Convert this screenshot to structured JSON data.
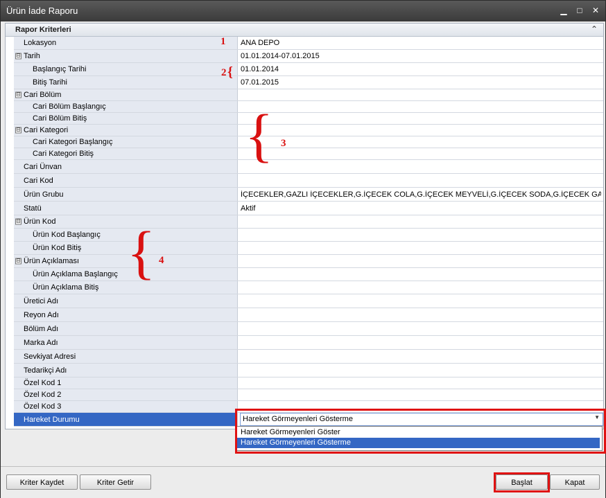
{
  "window": {
    "title": "Ürün İade Raporu",
    "min": "▁",
    "max": "□",
    "close": "✕"
  },
  "group": {
    "title": "Rapor Kriterleri",
    "collapse": "⌃"
  },
  "rows": [
    {
      "label": "Lokasyon",
      "value": "ANA DEPO"
    },
    {
      "label": "Tarih",
      "value": "01.01.2014-07.01.2015"
    },
    {
      "label": "Başlangıç Tarihi",
      "value": "01.01.2014"
    },
    {
      "label": "Bitiş Tarihi",
      "value": "07.01.2015"
    },
    {
      "label": "Cari Bölüm",
      "value": ""
    },
    {
      "label": "Cari Bölüm Başlangıç",
      "value": ""
    },
    {
      "label": "Cari Bölüm Bitiş",
      "value": ""
    },
    {
      "label": "Cari Kategori",
      "value": ""
    },
    {
      "label": "Cari Kategori Başlangıç",
      "value": ""
    },
    {
      "label": "Cari Kategori Bitiş",
      "value": ""
    },
    {
      "label": "Cari Ünvan",
      "value": ""
    },
    {
      "label": "Cari Kod",
      "value": ""
    },
    {
      "label": "Ürün Grubu",
      "value": "İÇECEKLER,GAZLI İÇECEKLER,G.İÇECEK COLA,G.İÇECEK MEYVELİ,G.İÇECEK SODA,G.İÇECEK GAZOZ,G...."
    },
    {
      "label": "Statü",
      "value": "Aktif"
    },
    {
      "label": "Ürün Kod",
      "value": ""
    },
    {
      "label": "Ürün Kod Başlangıç",
      "value": ""
    },
    {
      "label": "Ürün Kod Bitiş",
      "value": ""
    },
    {
      "label": "Ürün Açıklaması",
      "value": ""
    },
    {
      "label": "Ürün Açıklama Başlangıç",
      "value": ""
    },
    {
      "label": "Ürün Açıklama Bitiş",
      "value": ""
    },
    {
      "label": "Üretici Adı",
      "value": ""
    },
    {
      "label": "Reyon Adı",
      "value": ""
    },
    {
      "label": "Bölüm Adı",
      "value": ""
    },
    {
      "label": "Marka Adı",
      "value": ""
    },
    {
      "label": "Sevkiyat Adresi",
      "value": ""
    },
    {
      "label": "Tedarikçi Adı",
      "value": ""
    },
    {
      "label": "Özel Kod 1",
      "value": ""
    },
    {
      "label": "Özel Kod 2",
      "value": ""
    },
    {
      "label": "Özel Kod 3",
      "value": ""
    },
    {
      "label": "Hareket Durumu",
      "value": "Hareket Görmeyenleri Gösterme"
    }
  ],
  "expander": "⊟",
  "dropdown": {
    "arrow": "▼",
    "options": [
      "Hareket Görmeyenleri Göster",
      "Hareket Görmeyenleri Gösterme"
    ]
  },
  "annotations": {
    "a1": "1",
    "a2": "2",
    "brace_small": "{",
    "a3": "3",
    "a4": "4",
    "brace": "{"
  },
  "buttons": {
    "save": "Kriter Kaydet",
    "load": "Kriter Getir",
    "start": "Başlat",
    "close": "Kapat"
  },
  "colors": {
    "selection": "#3467c4",
    "highlight": "#e01212"
  }
}
